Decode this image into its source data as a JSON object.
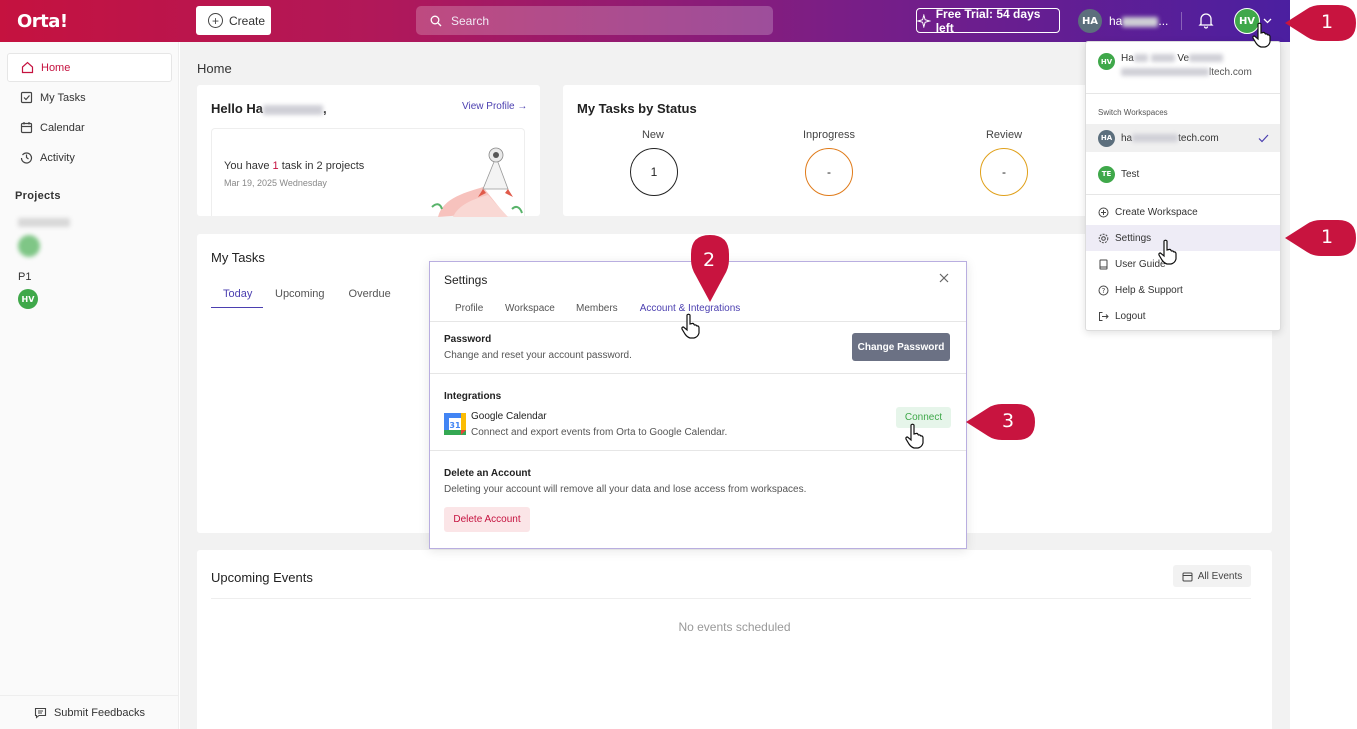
{
  "app": {
    "logo": "Orta!"
  },
  "topbar": {
    "create_label": "Create",
    "search_placeholder": "Search",
    "trial_label": "Free Trial: 54 days left",
    "workspace_initials": "HA",
    "workspace_name": "ha",
    "user_initials": "HV"
  },
  "sidebar": {
    "items": [
      {
        "label": "Home",
        "icon": "home-icon"
      },
      {
        "label": "My Tasks",
        "icon": "checkbox-icon"
      },
      {
        "label": "Calendar",
        "icon": "calendar-icon"
      },
      {
        "label": "Activity",
        "icon": "activity-icon"
      }
    ],
    "projects_heading": "Projects",
    "project_p1": "P1",
    "project_p1_member": "HV",
    "feedback_label": "Submit Feedbacks"
  },
  "home": {
    "title": "Home",
    "hello_prefix": "Hello Ha",
    "hello_suffix": ",",
    "view_profile": "View Profile →",
    "tasks_summary_a": "You have ",
    "tasks_summary_count": "1",
    "tasks_summary_b": " task in 2 projects",
    "date": "Mar 19, 2025 Wednesday"
  },
  "status": {
    "title": "My Tasks by Status",
    "items": [
      {
        "label": "New",
        "value": "1",
        "color": "#222222"
      },
      {
        "label": "Inprogress",
        "value": "-",
        "color": "#e07b1a"
      },
      {
        "label": "Review",
        "value": "-",
        "color": "#e0a01a"
      }
    ]
  },
  "my_tasks": {
    "title": "My Tasks",
    "tabs": [
      "Today",
      "Upcoming",
      "Overdue"
    ]
  },
  "events": {
    "title": "Upcoming Events",
    "all_events": "All Events",
    "empty": "No events scheduled"
  },
  "user_menu": {
    "user_initials": "HV",
    "user_name_a": "Ha",
    "user_name_b": "Ve",
    "user_email_suffix": "ltech.com",
    "switch_heading": "Switch Workspaces",
    "workspaces": [
      {
        "initials": "HA",
        "name_a": "ha",
        "name_b": "tech.com",
        "active": true
      },
      {
        "initials": "TE",
        "name_a": "Test",
        "name_b": "",
        "active": false
      }
    ],
    "actions": [
      "Create Workspace",
      "Settings",
      "User Guide",
      "Help & Support",
      "Logout"
    ]
  },
  "settings_modal": {
    "title": "Settings",
    "tabs": [
      "Profile",
      "Workspace",
      "Members",
      "Account & Integrations"
    ],
    "password_heading": "Password",
    "password_desc": "Change and reset your account password.",
    "change_password_btn": "Change Password",
    "integrations_heading": "Integrations",
    "gcal_name": "Google Calendar",
    "gcal_desc": "Connect and export events from Orta to Google Calendar.",
    "gcal_day": "31",
    "connect_btn": "Connect",
    "delete_heading": "Delete an Account",
    "delete_desc": "Deleting your account will remove all your data and lose access from workspaces.",
    "delete_btn": "Delete Account"
  },
  "callouts": {
    "avatar_step": "1",
    "settings_step": "1",
    "tab_step": "2",
    "connect_step": "3"
  },
  "colors": {
    "accent": "#c5123f",
    "callout": "#c8143f",
    "purple": "#4b1fa0"
  }
}
